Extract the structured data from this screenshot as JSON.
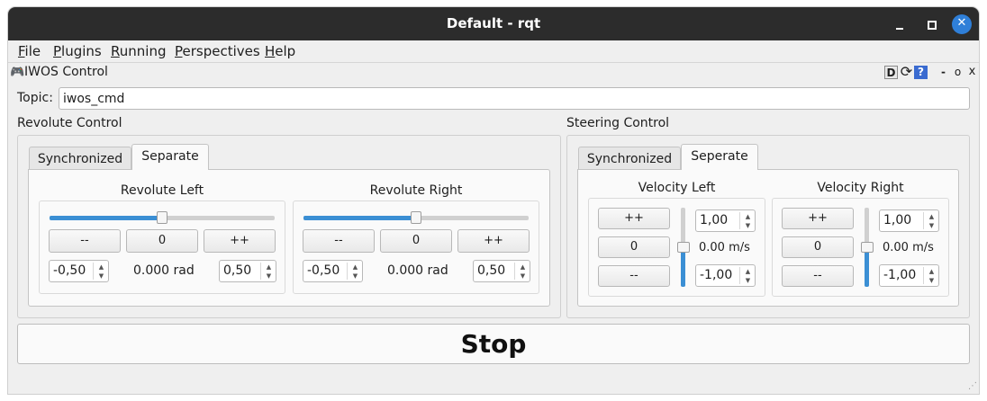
{
  "window": {
    "title": "Default - rqt"
  },
  "menu": {
    "file": "File",
    "plugins": "Plugins",
    "running": "Running",
    "perspectives": "Perspectives",
    "help": "Help"
  },
  "dock": {
    "title": "IWOS Control",
    "btn_d": "D",
    "btn_reload": "⟳",
    "btn_help": "?",
    "btn_min": "-",
    "btn_float": "o",
    "btn_close": "x"
  },
  "topic": {
    "label": "Topic:",
    "value": "iwos_cmd"
  },
  "revolute": {
    "title": "Revolute Control",
    "tabs": [
      "Synchronized",
      "Separate"
    ],
    "active_tab": "Separate",
    "left": {
      "label": "Revolute Left",
      "dec": "--",
      "zero": "0",
      "inc": "++",
      "min": "-0,50",
      "max": "0,50",
      "value": "0.000 rad",
      "slider_fraction": 0.5
    },
    "right": {
      "label": "Revolute Right",
      "dec": "--",
      "zero": "0",
      "inc": "++",
      "min": "-0,50",
      "max": "0,50",
      "value": "0.000 rad",
      "slider_fraction": 0.5
    }
  },
  "steering": {
    "title": "Steering Control",
    "tabs": [
      "Synchronized",
      "Seperate"
    ],
    "active_tab": "Seperate",
    "left": {
      "label": "Velocity Left",
      "inc": "++",
      "zero": "0",
      "dec": "--",
      "max": "1,00",
      "min": "-1,00",
      "value": "0.00 m/s",
      "slider_fraction": 0.5
    },
    "right": {
      "label": "Velocity Right",
      "inc": "++",
      "zero": "0",
      "dec": "--",
      "max": "1,00",
      "min": "-1,00",
      "value": "0.00 m/s",
      "slider_fraction": 0.5
    }
  },
  "stop_label": "Stop",
  "colors": {
    "titlebar": "#2c2c2c",
    "accent": "#3b8fd4",
    "close_button": "#2f7fd8",
    "background": "#efefef"
  }
}
